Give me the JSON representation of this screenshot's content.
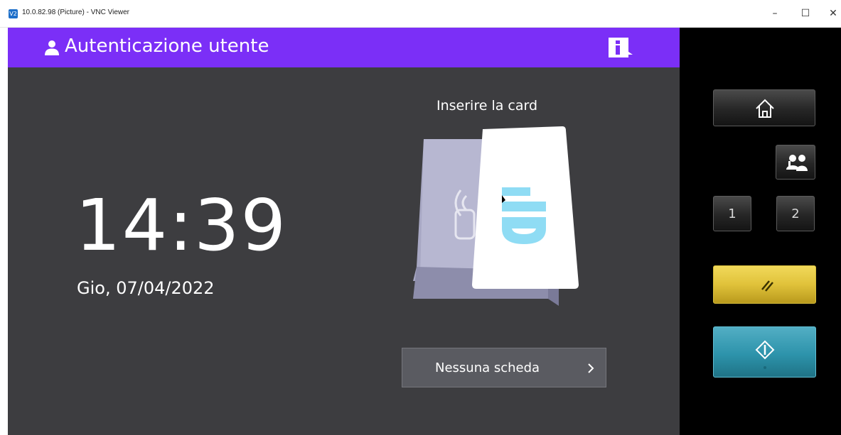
{
  "window": {
    "app_icon_text": "V2",
    "title": "10.0.82.98 (Picture) - VNC Viewer",
    "minimize": "–",
    "maximize": "☐",
    "close": "✕"
  },
  "header": {
    "title": "Autenticazione utente",
    "user_icon": "user-icon",
    "info_icon": "info-icon"
  },
  "clock": {
    "time": "14:39",
    "date": "Gio, 07/04/2022"
  },
  "card": {
    "prompt": "Inserire la card",
    "card_text": "ID",
    "illustration_icon": "card-reader-icon"
  },
  "no_card_button": {
    "label": "Nessuna scheda",
    "icon": "chevron-right-icon"
  },
  "side_panel": {
    "home_icon": "home-icon",
    "users_icon": "users-icon",
    "button_1": "1",
    "button_2": "2",
    "reset_icon": "reset-icon",
    "start_icon": "start-icon"
  },
  "colors": {
    "header": "#7b2ff7",
    "screen_bg": "#3d3d40",
    "reset_button": "#e0c23a",
    "start_button": "#2d93ab",
    "card_accent": "#8fdcf4"
  }
}
